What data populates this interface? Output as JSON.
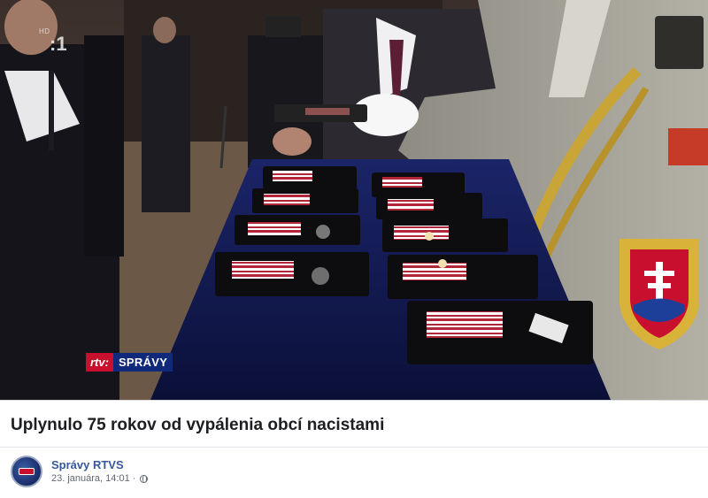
{
  "video": {
    "hd_label": "HD",
    "channel_label": ":1",
    "news_brand": "rtv:",
    "news_program": "SPRÁVY"
  },
  "post": {
    "title": "Uplynulo 75 rokov od vypálenia obcí nacistami",
    "page_name": "Správy RTVS",
    "date": "23. januára, 14:01 ·"
  },
  "colors": {
    "link": "#385898",
    "brand_red": "#c8102e",
    "brand_blue": "#11297a",
    "tablecloth": "#141b52"
  },
  "icons": [
    "globe-icon",
    "page-avatar-logo"
  ]
}
